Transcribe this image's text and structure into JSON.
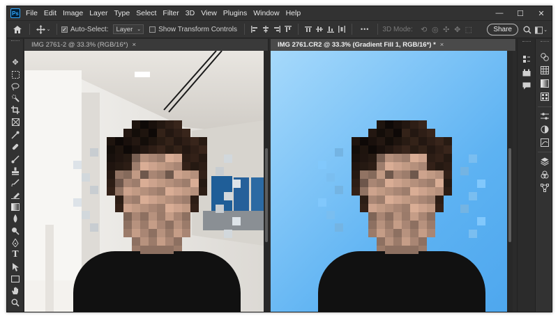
{
  "menu": {
    "logo": "Ps",
    "items": [
      "File",
      "Edit",
      "Image",
      "Layer",
      "Type",
      "Select",
      "Filter",
      "3D",
      "View",
      "Plugins",
      "Window",
      "Help"
    ]
  },
  "window_controls": {
    "minimize": "—",
    "maximize": "☐",
    "close": "✕"
  },
  "options": {
    "auto_select_label": "Auto-Select:",
    "auto_select_checked": true,
    "layer_select": "Layer",
    "show_transform_label": "Show Transform Controls",
    "mode_3d_label": "3D Mode:",
    "more": "•••",
    "share_label": "Share"
  },
  "documents": [
    {
      "title": "IMG 2761-2 @ 33.3% (RGB/16*)",
      "close": "×",
      "active": false
    },
    {
      "title": "IMG 2761.CR2 @ 33.3% (Gradient Fill 1, RGB/16*) *",
      "close": "×",
      "active": true
    }
  ],
  "colors": {
    "accent": "#31a8ff",
    "ui_dark": "#2b2b2b",
    "ui_panel": "#323232",
    "gradient_light": "#a6d9fb",
    "gradient_dark": "#4ea7ee",
    "shirt": "#111111",
    "hair": "#2c1d15",
    "skin": "#c9a08a"
  },
  "tool_icons": [
    "move-icon",
    "marquee-icon",
    "lasso-icon",
    "quick-select-icon",
    "crop-icon",
    "frame-icon",
    "eyedropper-icon",
    "spot-heal-icon",
    "brush-icon",
    "clone-stamp-icon",
    "history-brush-icon",
    "eraser-icon",
    "gradient-icon",
    "blur-icon",
    "dodge-icon",
    "pen-icon",
    "type-icon",
    "path-select-icon",
    "rectangle-icon",
    "hand-icon",
    "zoom-icon",
    "more-tools-icon"
  ]
}
